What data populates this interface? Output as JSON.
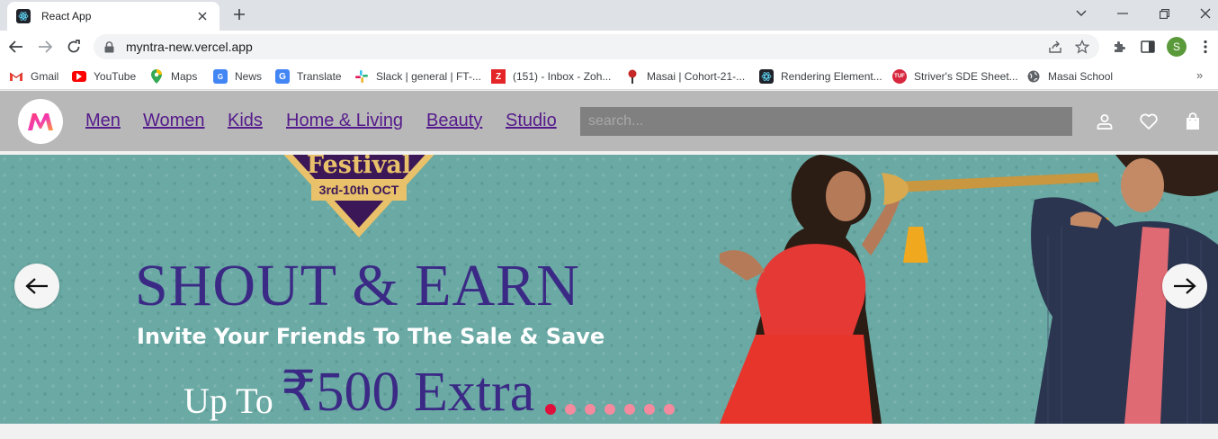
{
  "browser": {
    "tab_title": "React App",
    "url": "myntra-new.vercel.app",
    "profile_initial": "S",
    "bookmarks": [
      {
        "label": "Gmail",
        "icon": "gmail-icon",
        "color": "#ea4335"
      },
      {
        "label": "YouTube",
        "icon": "youtube-icon",
        "color": "#ff0000"
      },
      {
        "label": "Maps",
        "icon": "maps-icon",
        "color": "#34a853"
      },
      {
        "label": "News",
        "icon": "news-icon",
        "color": "#4285f4"
      },
      {
        "label": "Translate",
        "icon": "translate-icon",
        "color": "#4285f4"
      },
      {
        "label": "Slack | general | FT-...",
        "icon": "slack-icon",
        "color": "#611f69"
      },
      {
        "label": "(151) - Inbox - Zoh...",
        "icon": "zoho-icon",
        "color": "#e42527"
      },
      {
        "label": "Masai | Cohort-21-...",
        "icon": "masai-icon",
        "color": "#8b0000"
      },
      {
        "label": "Rendering Element...",
        "icon": "react-icon",
        "color": "#20232a"
      },
      {
        "label": "Striver's SDE Sheet...",
        "icon": "tuf-icon",
        "color": "#d7263d"
      },
      {
        "label": "Masai School",
        "icon": "globe-icon",
        "color": "#5f6368"
      }
    ]
  },
  "nav": {
    "links": [
      "Men",
      "Women",
      "Kids",
      "Home & Living",
      "Beauty",
      "Studio"
    ],
    "search_placeholder": "search..."
  },
  "banner": {
    "badge_title": "Festival",
    "badge_dates": "3rd-10th OCT",
    "headline": "SHOUT & EARN",
    "subline": "Invite Your Friends To The Sale & Save",
    "offer_prefix": "Up To",
    "offer_amount": "₹500 Extra",
    "slide_count": 7,
    "active_slide": 0
  },
  "colors": {
    "nav_bg": "#b8b8b8",
    "link": "#551a8b",
    "banner_bg": "#6aa9a4",
    "headline": "#3b2a85",
    "dot_active": "#e0103c",
    "dot": "#f48a9e"
  }
}
